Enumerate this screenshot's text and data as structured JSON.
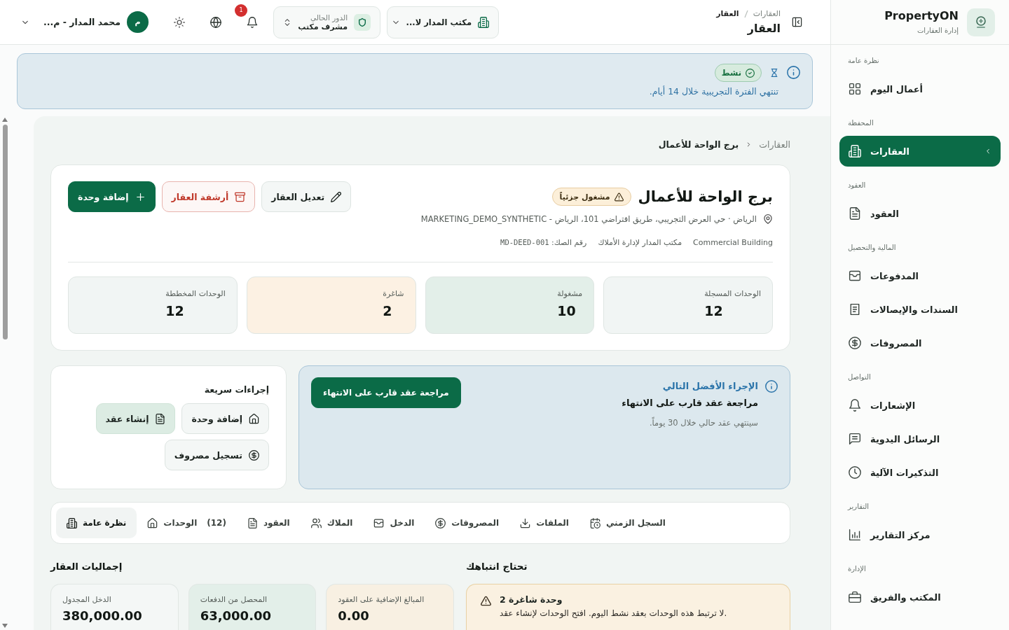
{
  "sidebar": {
    "brand": {
      "name": "PropertyON",
      "tagline": "إدارة العقارات"
    },
    "groups": [
      {
        "label": "نظرة عامة",
        "items": [
          {
            "label": "أعمال اليوم",
            "selected": false
          }
        ]
      },
      {
        "label": "المحفظة",
        "items": [
          {
            "label": "العقارات",
            "selected": true
          }
        ]
      },
      {
        "label": "العقود",
        "items": [
          {
            "label": "العقود",
            "selected": false
          }
        ]
      },
      {
        "label": "المالية والتحصيل",
        "items": [
          {
            "label": "المدفوعات",
            "selected": false
          },
          {
            "label": "السندات والإيصالات",
            "selected": false
          },
          {
            "label": "المصروفات",
            "selected": false
          }
        ]
      },
      {
        "label": "التواصل",
        "items": [
          {
            "label": "الإشعارات",
            "selected": false
          },
          {
            "label": "الرسائل اليدوية",
            "selected": false
          },
          {
            "label": "التذكيرات الآلية",
            "selected": false
          }
        ]
      },
      {
        "label": "التقارير",
        "items": [
          {
            "label": "مركز التقارير",
            "selected": false
          }
        ]
      },
      {
        "label": "الإدارة",
        "items": [
          {
            "label": "المكتب والفريق",
            "selected": false
          }
        ]
      }
    ]
  },
  "top_bar": {
    "breadcrumb": {
      "parent": "العقارات",
      "current": "العقار"
    },
    "title": "العقار",
    "office_select": {
      "value": "مكتب المدار لا..."
    },
    "role_select": {
      "label": "الدور الحالي",
      "value": "مشرف مكتب"
    },
    "notifications": {
      "count": "1"
    },
    "user": {
      "initial": "م",
      "name": "محمد المدار - م..."
    }
  },
  "trial_banner": {
    "status": "نشط",
    "message": "تنتهي الفترة التجريبية خلال 14 أيام."
  },
  "breadcrumb": {
    "parent": "العقارات",
    "current": "برج الواحة للأعمال"
  },
  "property": {
    "name": "برج الواحة للأعمال",
    "status": "مشغول جزئياً",
    "address": "الرياض · حي العرض التجريبي، طريق افتراضي 101، الرياض - MARKETING_DEMO_SYNTHETIC",
    "type": "Commercial Building",
    "office": "مكتب المدار لإدارة الأملاك",
    "deed": {
      "label": "رقم الصك:",
      "value": "MD-DEED-001"
    },
    "actions": [
      {
        "kind": "edit",
        "label": "تعديل العقار"
      },
      {
        "kind": "archive",
        "label": "أرشفة العقار"
      },
      {
        "kind": "add",
        "label": "إضافة وحدة"
      }
    ],
    "stats": [
      {
        "label": "الوحدات المسجلة",
        "value": "12",
        "color": "#f1f5f4"
      },
      {
        "label": "مشغولة",
        "value": "10",
        "color": "#e3efe9"
      },
      {
        "label": "شاغرة",
        "value": "2",
        "color": "#fcf1e3"
      },
      {
        "label": "الوحدات المخططة",
        "value": "12",
        "color": "#f1f5f4"
      }
    ]
  },
  "next_action": {
    "heading": "الإجراء الأفضل التالي",
    "title": "مراجعة عقد قارب على الانتهاء",
    "description": "سينتهي عقد حالي خلال 30 يوماً.",
    "button": "مراجعة عقد قارب على الانتهاء"
  },
  "quick_actions": {
    "title": "إجراءات سريعة",
    "actions": [
      {
        "kind": "unit",
        "label": "إضافة وحدة"
      },
      {
        "kind": "contract",
        "label": "إنشاء عقد"
      },
      {
        "kind": "expense",
        "label": "تسجيل مصروف"
      }
    ]
  },
  "tabs": [
    {
      "label": "السجل الزمني",
      "selected": false
    },
    {
      "label": "الملفات",
      "selected": false
    },
    {
      "label": "المصروفات",
      "selected": false
    },
    {
      "label": "الدخل",
      "selected": false
    },
    {
      "label": "الملاك",
      "selected": false
    },
    {
      "label": "العقود",
      "selected": false
    },
    {
      "label": "الوحدات",
      "count": "(12)",
      "selected": false
    },
    {
      "label": "نظرة عامة",
      "selected": true
    }
  ],
  "attention": {
    "title": "تحتاج انتباهك",
    "items": [
      {
        "title": "وحدة شاغرة 2",
        "description": "لا ترتبط هذه الوحدات بعقد نشط اليوم. افتح الوحدات لإنشاء عقد."
      }
    ]
  },
  "totals": {
    "title": "إجماليات العقار",
    "cards": [
      {
        "label": "المبالغ الإضافية على العقود",
        "value": "0.00",
        "color": "#f8f0e2"
      },
      {
        "label": "المحصل من الدفعات",
        "value": "63,000.00",
        "color": "#e3efe9"
      },
      {
        "label": "الدخل المجدول",
        "value": "380,000.00",
        "color": "#f4f7f6"
      }
    ]
  }
}
